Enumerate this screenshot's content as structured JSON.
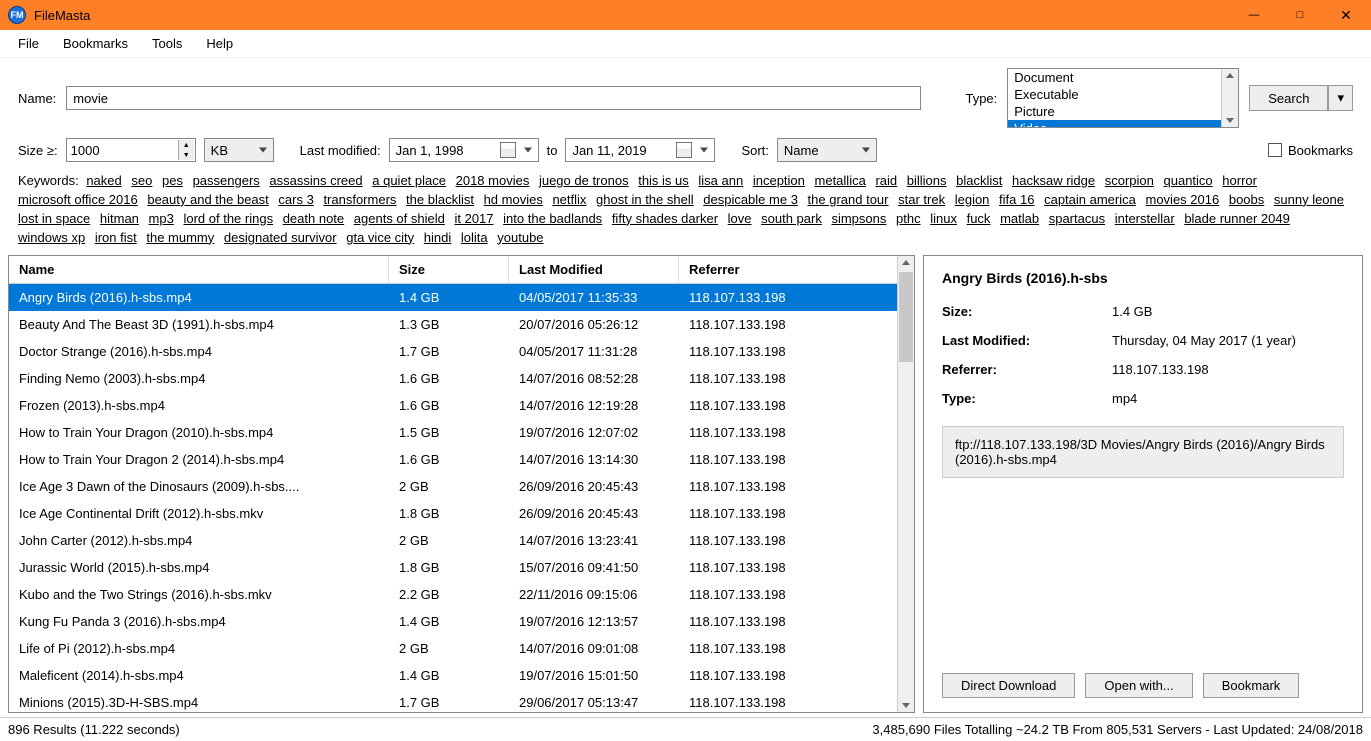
{
  "window": {
    "title": "FileMasta",
    "icon_text": "FM"
  },
  "menu": [
    "File",
    "Bookmarks",
    "Tools",
    "Help"
  ],
  "search": {
    "name_label": "Name:",
    "name_value": "movie",
    "type_label": "Type:",
    "type_options": [
      "Document",
      "Executable",
      "Picture",
      "Video"
    ],
    "type_selected": "Video",
    "search_btn": "Search",
    "size_label": "Size ≥:",
    "size_value": "1000",
    "size_unit": "KB",
    "lastmod_label": "Last modified:",
    "date_from": "Jan  1, 1998",
    "date_to_label": "to",
    "date_to": "Jan 11, 2019",
    "sort_label": "Sort:",
    "sort_value": "Name",
    "bookmarks_chk": "Bookmarks"
  },
  "keywords_label": "Keywords:",
  "keywords": [
    "naked",
    "seo",
    "pes",
    "passengers",
    "assassins creed",
    "a quiet place",
    "2018 movies",
    "juego de tronos",
    "this is us",
    "lisa ann",
    "inception",
    "metallica",
    "raid",
    "billions",
    "blacklist",
    "hacksaw ridge",
    "scorpion",
    "quantico",
    "horror",
    "microsoft office 2016",
    "beauty and the beast",
    "cars 3",
    "transformers",
    "the blacklist",
    "hd movies",
    "netflix",
    "ghost in the shell",
    "despicable me 3",
    "the grand tour",
    "star trek",
    "legion",
    "fifa 16",
    "captain america",
    "movies 2016",
    "boobs",
    "sunny leone",
    "lost in space",
    "hitman",
    "mp3",
    "lord of the rings",
    "death note",
    "agents of shield",
    "it 2017",
    "into the badlands",
    "fifty shades darker",
    "love",
    "south park",
    "simpsons",
    "pthc",
    "linux",
    "fuck",
    "matlab",
    "spartacus",
    "interstellar",
    "blade runner 2049",
    "windows xp",
    "iron fist",
    "the mummy",
    "designated survivor",
    "gta vice city",
    "hindi",
    "lolita",
    "youtube"
  ],
  "columns": [
    "Name",
    "Size",
    "Last Modified",
    "Referrer"
  ],
  "rows": [
    {
      "name": "Angry Birds (2016).h-sbs.mp4",
      "size": "1.4 GB",
      "mod": "04/05/2017 11:35:33",
      "ref": "118.107.133.198",
      "selected": true
    },
    {
      "name": "Beauty And The Beast 3D (1991).h-sbs.mp4",
      "size": "1.3 GB",
      "mod": "20/07/2016 05:26:12",
      "ref": "118.107.133.198"
    },
    {
      "name": "Doctor Strange (2016).h-sbs.mp4",
      "size": "1.7 GB",
      "mod": "04/05/2017 11:31:28",
      "ref": "118.107.133.198"
    },
    {
      "name": "Finding Nemo (2003).h-sbs.mp4",
      "size": "1.6 GB",
      "mod": "14/07/2016 08:52:28",
      "ref": "118.107.133.198"
    },
    {
      "name": "Frozen (2013).h-sbs.mp4",
      "size": "1.6 GB",
      "mod": "14/07/2016 12:19:28",
      "ref": "118.107.133.198"
    },
    {
      "name": "How to Train Your Dragon (2010).h-sbs.mp4",
      "size": "1.5 GB",
      "mod": "19/07/2016 12:07:02",
      "ref": "118.107.133.198"
    },
    {
      "name": "How to Train Your Dragon 2 (2014).h-sbs.mp4",
      "size": "1.6 GB",
      "mod": "14/07/2016 13:14:30",
      "ref": "118.107.133.198"
    },
    {
      "name": "Ice Age 3 Dawn of the Dinosaurs (2009).h-sbs....",
      "size": "2 GB",
      "mod": "26/09/2016 20:45:43",
      "ref": "118.107.133.198"
    },
    {
      "name": "Ice Age Continental Drift (2012).h-sbs.mkv",
      "size": "1.8 GB",
      "mod": "26/09/2016 20:45:43",
      "ref": "118.107.133.198"
    },
    {
      "name": "John Carter (2012).h-sbs.mp4",
      "size": "2 GB",
      "mod": "14/07/2016 13:23:41",
      "ref": "118.107.133.198"
    },
    {
      "name": "Jurassic World (2015).h-sbs.mp4",
      "size": "1.8 GB",
      "mod": "15/07/2016 09:41:50",
      "ref": "118.107.133.198"
    },
    {
      "name": "Kubo and the Two Strings (2016).h-sbs.mkv",
      "size": "2.2 GB",
      "mod": "22/11/2016 09:15:06",
      "ref": "118.107.133.198"
    },
    {
      "name": "Kung Fu Panda 3 (2016).h-sbs.mp4",
      "size": "1.4 GB",
      "mod": "19/07/2016 12:13:57",
      "ref": "118.107.133.198"
    },
    {
      "name": "Life of Pi (2012).h-sbs.mp4",
      "size": "2 GB",
      "mod": "14/07/2016 09:01:08",
      "ref": "118.107.133.198"
    },
    {
      "name": "Maleficent (2014).h-sbs.mp4",
      "size": "1.4 GB",
      "mod": "19/07/2016 15:01:50",
      "ref": "118.107.133.198"
    },
    {
      "name": "Minions (2015).3D-H-SBS.mp4",
      "size": "1.7 GB",
      "mod": "29/06/2017 05:13:47",
      "ref": "118.107.133.198"
    }
  ],
  "detail": {
    "title": "Angry Birds (2016).h-sbs",
    "size_label": "Size:",
    "size": "1.4 GB",
    "mod_label": "Last Modified:",
    "mod": "Thursday, 04 May 2017 (1 year)",
    "ref_label": "Referrer:",
    "ref": "118.107.133.198",
    "type_label": "Type:",
    "type": "mp4",
    "url": "ftp://118.107.133.198/3D Movies/Angry Birds (2016)/Angry Birds (2016).h-sbs.mp4",
    "btn_download": "Direct Download",
    "btn_open": "Open with...",
    "btn_bookmark": "Bookmark"
  },
  "status": {
    "left": "896 Results (11.222 seconds)",
    "right": "3,485,690 Files Totalling ~24.2 TB From 805,531 Servers - Last Updated: 24/08/2018"
  }
}
